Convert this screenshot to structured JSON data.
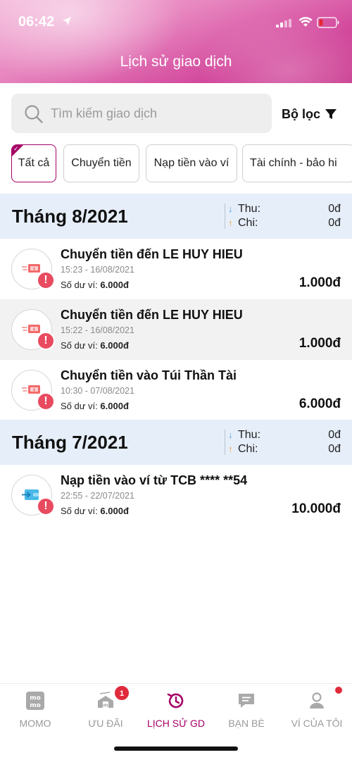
{
  "status_bar": {
    "time": "06:42"
  },
  "header": {
    "title": "Lịch sử giao dịch"
  },
  "search": {
    "placeholder": "Tìm kiếm giao dịch"
  },
  "filter": {
    "label": "Bộ lọc"
  },
  "chips": [
    {
      "label": "Tất cả",
      "active": true
    },
    {
      "label": "Chuyển tiền"
    },
    {
      "label": "Nạp tiền vào ví"
    },
    {
      "label": "Tài chính - bảo hi"
    }
  ],
  "months": [
    {
      "title": "Tháng 8/2021",
      "income_label": "Thu:",
      "income_value": "0đ",
      "expense_label": "Chi:",
      "expense_value": "0đ",
      "transactions": [
        {
          "title": "Chuyển tiền đến LE HUY HIEU",
          "time": "15:23 - 16/08/2021",
          "balance_label": "Số dư ví:",
          "balance": "6.000đ",
          "amount": "1.000đ",
          "icon": "money-transfer-icon"
        },
        {
          "title": "Chuyển tiền đến LE HUY HIEU",
          "time": "15:22 - 16/08/2021",
          "balance_label": "Số dư ví:",
          "balance": "6.000đ",
          "amount": "1.000đ",
          "icon": "money-transfer-icon"
        },
        {
          "title": "Chuyển tiền vào Túi Thần Tài",
          "time": "10:30 - 07/08/2021",
          "balance_label": "Số dư ví:",
          "balance": "6.000đ",
          "amount": "6.000đ",
          "icon": "money-transfer-icon"
        }
      ]
    },
    {
      "title": "Tháng 7/2021",
      "income_label": "Thu:",
      "income_value": "0đ",
      "expense_label": "Chi:",
      "expense_value": "0đ",
      "transactions": [
        {
          "title": "Nạp tiền vào ví từ TCB **** **54",
          "time": "22:55 - 22/07/2021",
          "balance_label": "Số dư ví:",
          "balance": "6.000đ",
          "amount": "10.000đ",
          "icon": "wallet-topup-icon"
        }
      ]
    }
  ],
  "bottom_nav": {
    "items": [
      {
        "label": "MOMO",
        "icon": "momo-logo-icon"
      },
      {
        "label": "ƯU ĐÃI",
        "icon": "promotion-icon",
        "badge": "1"
      },
      {
        "label": "LỊCH SỬ GD",
        "icon": "history-icon",
        "active": true
      },
      {
        "label": "BẠN BÈ",
        "icon": "chat-icon"
      },
      {
        "label": "VÍ CỦA TÔI",
        "icon": "profile-icon"
      }
    ]
  },
  "colors": {
    "brand": "#a50064",
    "alert": "#e84a5f",
    "month_header_bg": "#e6eef9",
    "income_arrow": "#4a9ee0",
    "expense_arrow": "#f0a030"
  }
}
